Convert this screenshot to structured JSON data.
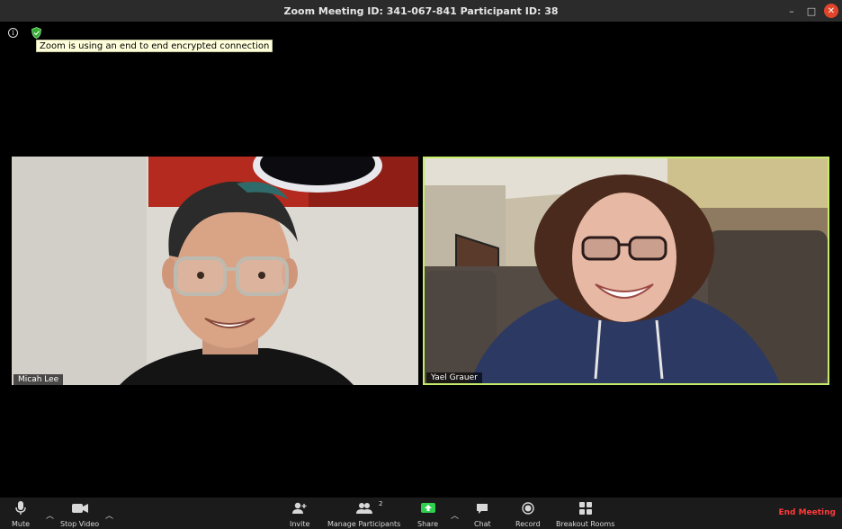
{
  "window": {
    "title": "Zoom Meeting ID: 341-067-841 Participant ID: 38",
    "controls": [
      "minimize",
      "maximize",
      "close"
    ]
  },
  "encryption": {
    "tooltip": "Zoom is using an end to end encrypted connection",
    "icons": [
      "info-icon",
      "shield-icon"
    ]
  },
  "participants": [
    {
      "name": "Micah Lee",
      "active_speaker": false
    },
    {
      "name": "Yael Grauer",
      "active_speaker": true
    }
  ],
  "toolbar": {
    "mute_label": "Mute",
    "stop_video_label": "Stop Video",
    "invite_label": "Invite",
    "manage_participants_label": "Manage Participants",
    "participant_count": "2",
    "share_label": "Share",
    "chat_label": "Chat",
    "record_label": "Record",
    "breakout_rooms_label": "Breakout Rooms",
    "end_meeting_label": "End Meeting"
  },
  "colors": {
    "active_speaker_border": "#c6ec6b",
    "share_green": "#2fcf4f",
    "end_meeting_red": "#ff3b3b",
    "titlebar": "#2b2b2b",
    "toolbar": "#1b1b1b"
  }
}
